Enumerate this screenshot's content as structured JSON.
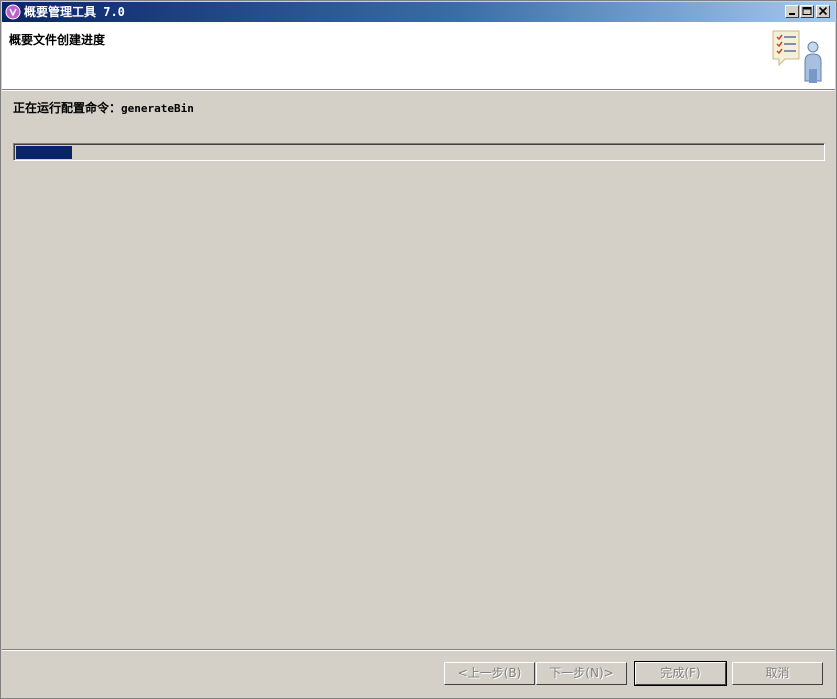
{
  "window": {
    "title": "概要管理工具 7.0",
    "accent_color": "#0a246a"
  },
  "header": {
    "title": "概要文件创建进度",
    "icon": "wizard-checklist-person-icon"
  },
  "content": {
    "status_prefix": "正在运行配置命令：",
    "status_command": "generateBin",
    "progress": 0.07
  },
  "footer": {
    "back_label": "<上一步(B)",
    "next_label": "下一步(N)>",
    "finish_label": "完成(F)",
    "cancel_label": "取消",
    "buttons_enabled": false
  }
}
